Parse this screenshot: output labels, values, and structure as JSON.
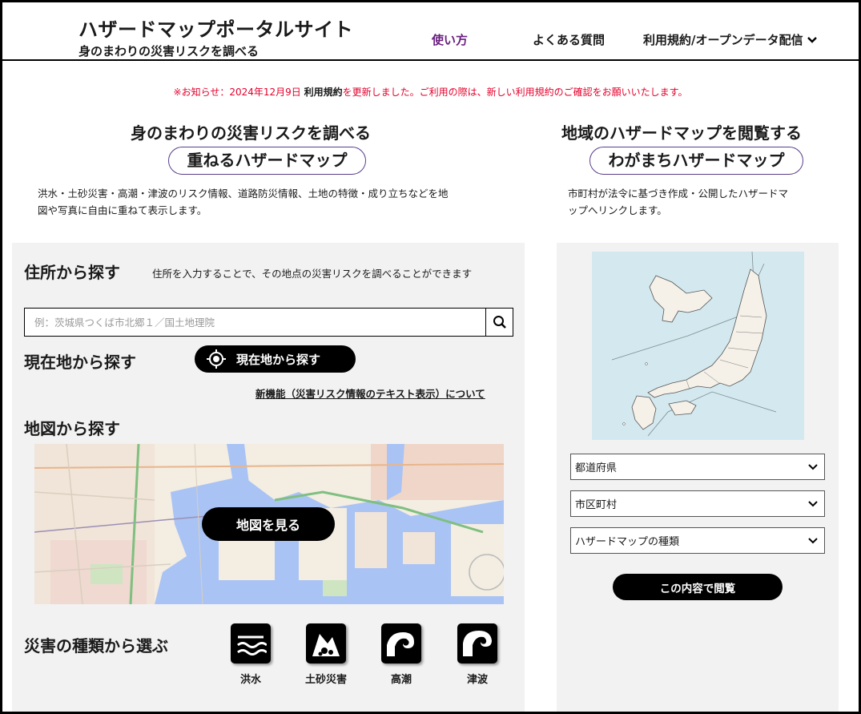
{
  "header": {
    "site_title": "ハザードマップポータルサイト",
    "site_subtitle": "身のまわりの災害リスクを調べる",
    "nav_usage": "使い方",
    "nav_faq": "よくある質問",
    "nav_terms": "利用規約/オープンデータ配信"
  },
  "notice": {
    "prefix": "※お知らせ：2024年12月9日",
    "link": "利用規約",
    "suffix": "を更新しました。ご利用の際は、新しい利用規約のご確認をお願いいたします。"
  },
  "left": {
    "heading": "身のまわりの災害リスクを調べる",
    "pill": "重ねるハザードマップ",
    "desc_line1": "洪水・土砂災害・高潮・津波のリスク情報、道路防災情報、土地の特徴・成り立ちなどを地",
    "desc_line2": "図や写真に自由に重ねて表示します。",
    "address_title": "住所から探す",
    "address_note": "住所を入力することで、その地点の災害リスクを調べることができます",
    "search_placeholder": "例：茨城県つくば市北郷１／国土地理院",
    "current_title": "現在地から探す",
    "current_button": "現在地から探す",
    "new_feature_link": "新機能（災害リスク情報のテキスト表示）について",
    "map_title": "地図から探す",
    "map_button": "地図を見る",
    "hazard_title": "災害の種類から選ぶ",
    "hazards": [
      "洪水",
      "土砂災害",
      "高潮",
      "津波"
    ]
  },
  "right": {
    "heading": "地域のハザードマップを閲覧する",
    "pill": "わがまちハザードマップ",
    "desc_line1": "市町村が法令に基づき作成・公開したハザードマ",
    "desc_line2": "ップへリンクします。",
    "select_pref": "都道府県",
    "select_city": "市区町村",
    "select_type": "ハザードマップの種類",
    "view_button": "この内容で閲覧"
  },
  "colors": {
    "accent_purple": "#6a2080",
    "notice_red": "#e4002b",
    "panel_bg": "#f2f2f2",
    "map_water": "#a9c3f5",
    "japan_sea": "#d4e9ef"
  }
}
